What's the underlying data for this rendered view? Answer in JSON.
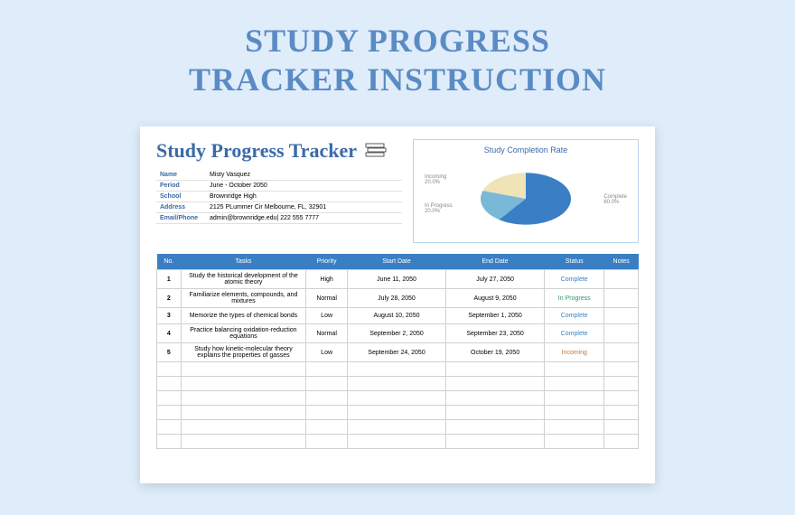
{
  "page_title_line1": "STUDY PROGRESS",
  "page_title_line2": "TRACKER INSTRUCTION",
  "tracker_title": "Study Progress Tracker",
  "meta": {
    "name_label": "Name",
    "name_value": "Misty Vasquez",
    "period_label": "Period",
    "period_value": "June - October 2050",
    "school_label": "School",
    "school_value": "Brownridge High",
    "address_label": "Address",
    "address_value": "2125 PLummer Cir Melbourne, FL, 32901",
    "email_label": "Email/Phone",
    "email_value": "admin@brownridge.edu| 222 555 7777"
  },
  "chart_data": {
    "type": "pie",
    "title": "Study Completion Rate",
    "series": [
      {
        "name": "Complete",
        "value": 60,
        "label": "60.0%"
      },
      {
        "name": "Incoming",
        "value": 20,
        "label": "20.0%"
      },
      {
        "name": "In Progress",
        "value": 20,
        "label": "20.0%"
      }
    ]
  },
  "columns": {
    "no": "No.",
    "tasks": "Tasks",
    "priority": "Priority",
    "start": "Start Date",
    "end": "End Date",
    "status": "Status",
    "notes": "Notes"
  },
  "rows": [
    {
      "no": "1",
      "task": "Study the historical development of the atomic theory",
      "priority": "High",
      "start": "June 11, 2050",
      "end": "July 27, 2050",
      "status": "Complete",
      "notes": ""
    },
    {
      "no": "2",
      "task": "Familiarize elements, compounds, and mixtures",
      "priority": "Normal",
      "start": "July 28, 2050",
      "end": "August 9, 2050",
      "status": "In Progress",
      "notes": ""
    },
    {
      "no": "3",
      "task": "Memorize the types of chemical bonds",
      "priority": "Low",
      "start": "August 10, 2050",
      "end": "September 1, 2050",
      "status": "Complete",
      "notes": ""
    },
    {
      "no": "4",
      "task": "Practice balancing oxidation-reduction equations",
      "priority": "Normal",
      "start": "September 2, 2050",
      "end": "September 23, 2050",
      "status": "Complete",
      "notes": ""
    },
    {
      "no": "5",
      "task": "Study how kinetic-molecular theory explains the properties of gasses",
      "priority": "Low",
      "start": "September 24, 2050",
      "end": "October 19, 2050",
      "status": "Incoming",
      "notes": ""
    }
  ]
}
